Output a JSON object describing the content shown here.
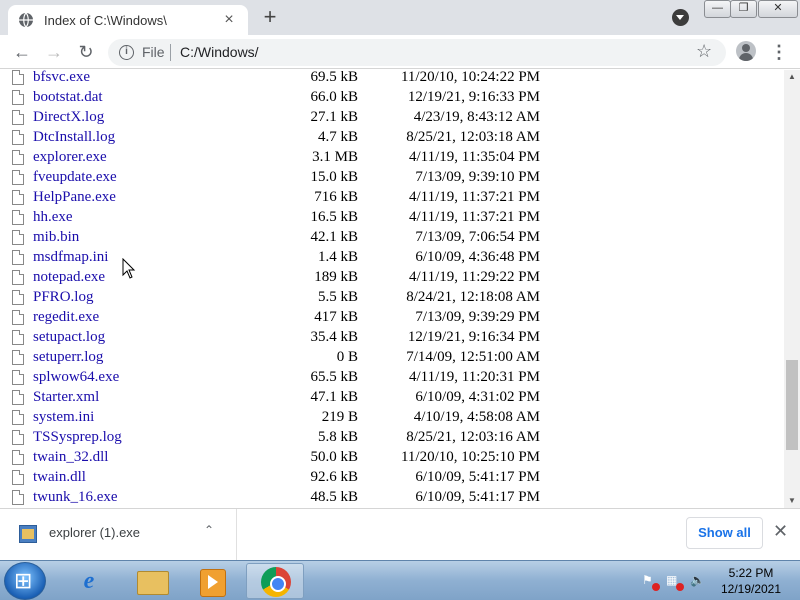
{
  "browser": {
    "tab_title": "Index of C:\\Windows\\",
    "tab_close": "×",
    "new_tab": "+",
    "window_controls": {
      "minimize": "—",
      "maximize": "❐",
      "close": "✕"
    },
    "nav": {
      "back": "←",
      "forward": "→",
      "reload": "↻"
    },
    "omnibox": {
      "scheme_label": "File",
      "url": "C:/Windows/",
      "info_icon": "i",
      "star": "☆"
    },
    "menu": "⋮"
  },
  "listing": [
    {
      "name": "bfsvc.exe",
      "size": "69.5 kB",
      "date": "11/20/10, 10:24:22 PM"
    },
    {
      "name": "bootstat.dat",
      "size": "66.0 kB",
      "date": "12/19/21, 9:16:33 PM"
    },
    {
      "name": "DirectX.log",
      "size": "27.1 kB",
      "date": "4/23/19, 8:43:12 AM"
    },
    {
      "name": "DtcInstall.log",
      "size": "4.7 kB",
      "date": "8/25/21, 12:03:18 AM"
    },
    {
      "name": "explorer.exe",
      "size": "3.1 MB",
      "date": "4/11/19, 11:35:04 PM"
    },
    {
      "name": "fveupdate.exe",
      "size": "15.0 kB",
      "date": "7/13/09, 9:39:10 PM"
    },
    {
      "name": "HelpPane.exe",
      "size": "716 kB",
      "date": "4/11/19, 11:37:21 PM"
    },
    {
      "name": "hh.exe",
      "size": "16.5 kB",
      "date": "4/11/19, 11:37:21 PM"
    },
    {
      "name": "mib.bin",
      "size": "42.1 kB",
      "date": "7/13/09, 7:06:54 PM"
    },
    {
      "name": "msdfmap.ini",
      "size": "1.4 kB",
      "date": "6/10/09, 4:36:48 PM"
    },
    {
      "name": "notepad.exe",
      "size": "189 kB",
      "date": "4/11/19, 11:29:22 PM"
    },
    {
      "name": "PFRO.log",
      "size": "5.5 kB",
      "date": "8/24/21, 12:18:08 AM"
    },
    {
      "name": "regedit.exe",
      "size": "417 kB",
      "date": "7/13/09, 9:39:29 PM"
    },
    {
      "name": "setupact.log",
      "size": "35.4 kB",
      "date": "12/19/21, 9:16:34 PM"
    },
    {
      "name": "setuperr.log",
      "size": "0 B",
      "date": "7/14/09, 12:51:00 AM"
    },
    {
      "name": "splwow64.exe",
      "size": "65.5 kB",
      "date": "4/11/19, 11:20:31 PM"
    },
    {
      "name": "Starter.xml",
      "size": "47.1 kB",
      "date": "6/10/09, 4:31:02 PM"
    },
    {
      "name": "system.ini",
      "size": "219 B",
      "date": "4/10/19, 4:58:08 AM"
    },
    {
      "name": "TSSysprep.log",
      "size": "5.8 kB",
      "date": "8/25/21, 12:03:16 AM"
    },
    {
      "name": "twain_32.dll",
      "size": "50.0 kB",
      "date": "11/20/10, 10:25:10 PM"
    },
    {
      "name": "twain.dll",
      "size": "92.6 kB",
      "date": "6/10/09, 5:41:17 PM"
    },
    {
      "name": "twunk_16.exe",
      "size": "48.5 kB",
      "date": "6/10/09, 5:41:17 PM"
    }
  ],
  "download_shelf": {
    "item_name": "explorer (1).exe",
    "chevron": "⌃",
    "show_all": "Show all",
    "close": "✕"
  },
  "taskbar": {
    "ie_glyph": "e",
    "clock_time": "5:22 PM",
    "clock_date": "12/19/2021"
  }
}
